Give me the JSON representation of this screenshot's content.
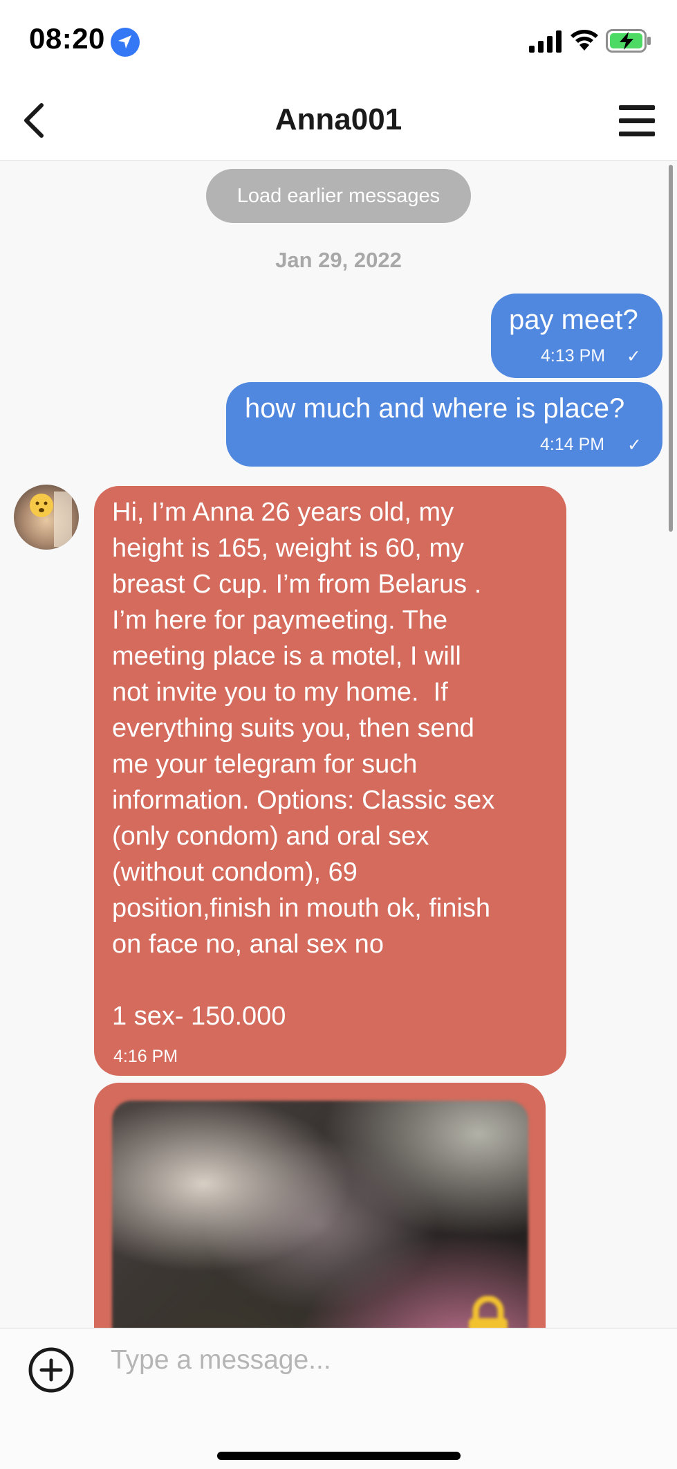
{
  "status_bar": {
    "time": "08:20",
    "icons": [
      "location-arrow-icon",
      "cellular-signal-icon",
      "wifi-icon",
      "battery-charging-icon"
    ]
  },
  "header": {
    "title": "Anna001",
    "icons": [
      "back-chevron-icon",
      "hamburger-menu-icon"
    ]
  },
  "conversation": {
    "load_earlier_label": "Load earlier messages",
    "date_label": "Jan 29, 2022",
    "outgoing": [
      {
        "text": "pay meet?",
        "time": "4:13 PM",
        "status": "✓"
      },
      {
        "text": "how much and where is place?",
        "time": "4:14 PM",
        "status": "✓"
      }
    ],
    "incoming": [
      {
        "text": "Hi, I’m Anna 26 years old, my\nheight is 165, weight is 60, my\nbreast C cup. I’m from Belarus .\nI’m here for paymeeting. The\nmeeting place is a motel, I will\nnot invite you to my home.  If\neverything suits you, then send\nme your telegram for such\ninformation. Options: Classic sex\n(only condom) and oral sex\n(without condom), 69\nposition,finish in mouth ok, finish\non face no, anal sex no\n\n1 sex- 150.000",
        "time": "4:16 PM"
      }
    ],
    "locked_image": {
      "icon": "lock-icon",
      "locked": true
    }
  },
  "composer": {
    "placeholder": "Type a message...",
    "add_icon": "plus-circle-icon"
  },
  "colors": {
    "outgoing_bubble": "#5088e0",
    "incoming_bubble": "#d46b5c",
    "load_earlier_bg": "#b3b3b3",
    "location_blue": "#3478f6",
    "battery_green": "#4cd964",
    "lock_yellow": "#f2c230"
  }
}
